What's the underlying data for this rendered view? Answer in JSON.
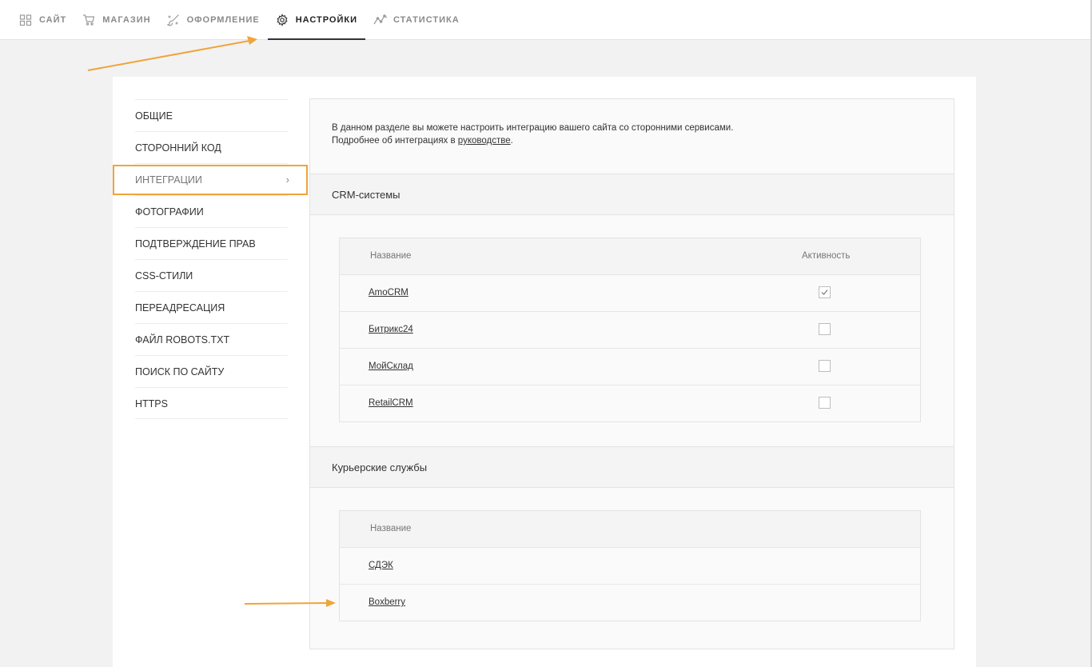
{
  "topnav": {
    "tabs": [
      {
        "label": "САЙТ",
        "icon": "grid-icon"
      },
      {
        "label": "МАГАЗИН",
        "icon": "cart-icon"
      },
      {
        "label": "ОФОРМЛЕНИЕ",
        "icon": "brush-icon"
      },
      {
        "label": "НАСТРОЙКИ",
        "icon": "gear-icon",
        "active": true
      },
      {
        "label": "СТАТИСТИКА",
        "icon": "chart-line-icon"
      }
    ]
  },
  "sidebar": {
    "items": [
      {
        "label": "ОБЩИЕ"
      },
      {
        "label": "СТОРОННИЙ КОД"
      },
      {
        "label": "ИНТЕГРАЦИИ",
        "active": true
      },
      {
        "label": "ФОТОГРАФИИ"
      },
      {
        "label": "ПОДТВЕРЖДЕНИЕ ПРАВ"
      },
      {
        "label": "CSS-СТИЛИ"
      },
      {
        "label": "ПЕРЕАДРЕСАЦИЯ"
      },
      {
        "label": "ФАЙЛ ROBOTS.TXT"
      },
      {
        "label": "ПОИСК ПО САЙТУ"
      },
      {
        "label": "HTTPS"
      }
    ],
    "chevron": "›"
  },
  "intro": {
    "line1": "В данном разделе вы можете настроить интеграцию вашего сайта со сторонними сервисами.",
    "line2_prefix": "Подробнее об интеграциях в ",
    "line2_link": "руководстве",
    "line2_suffix": "."
  },
  "crm": {
    "title": "CRM-системы",
    "col_name": "Название",
    "col_active": "Активность",
    "rows": [
      {
        "name": "AmoCRM",
        "active": true
      },
      {
        "name": "Битрикс24",
        "active": false
      },
      {
        "name": "МойСклад",
        "active": false
      },
      {
        "name": "RetailCRM",
        "active": false
      }
    ]
  },
  "couriers": {
    "title": "Курьерские службы",
    "col_name": "Название",
    "rows": [
      {
        "name": "СДЭК"
      },
      {
        "name": "Boxberry"
      }
    ]
  },
  "colors": {
    "accent_arrow": "#f0a43a",
    "active_tab_underline": "#333333"
  }
}
